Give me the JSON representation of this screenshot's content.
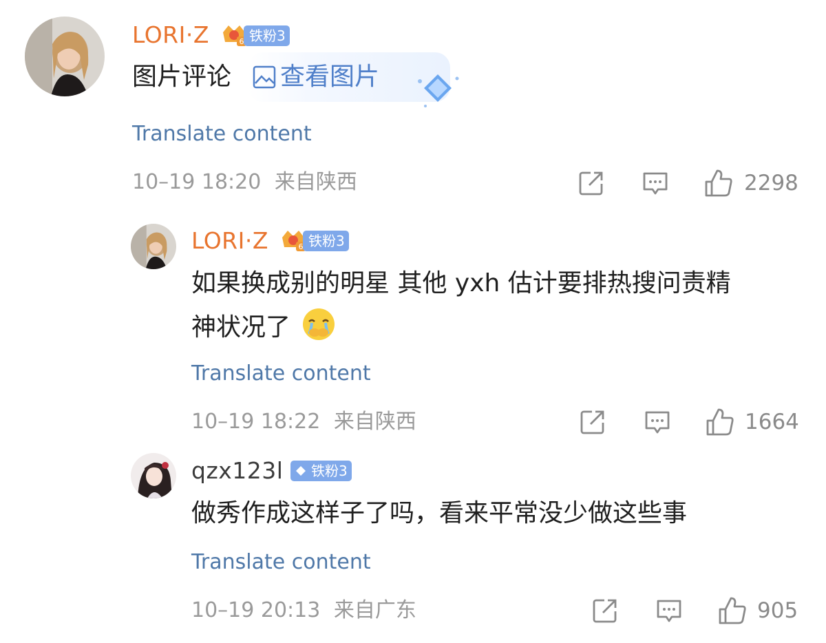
{
  "comments": [
    {
      "user": "LORI·Z",
      "badge": "铁粉3",
      "text": "图片评论",
      "image_link": "查看图片",
      "translate": "Translate content",
      "time": "10–19 18:20",
      "location": "来自陕西",
      "likes": "2298"
    },
    {
      "user": "LORI·Z",
      "badge": "铁粉3",
      "text_line1": "如果换成别的明星 其他 yxh 估计要排热搜问责精",
      "text_line2": "神状况了",
      "translate": "Translate content",
      "time": "10–19 18:22",
      "location": "来自陕西",
      "likes": "1664"
    },
    {
      "user": "qzx123l",
      "badge": "铁粉3",
      "text": "做秀作成这样子了吗，看来平常没少做这些事",
      "translate": "Translate content",
      "time": "10–19 20:13",
      "location": "来自广东",
      "likes": "905"
    }
  ],
  "icons": [
    "share-icon",
    "comment-icon",
    "like-icon",
    "image-icon",
    "crown-icon",
    "diamond-icon",
    "cry-emoji-icon"
  ],
  "colors": {
    "username": "#e8742e",
    "badge": "#7fa8ea",
    "link": "#4f78a8",
    "meta": "#9a9a9a"
  }
}
